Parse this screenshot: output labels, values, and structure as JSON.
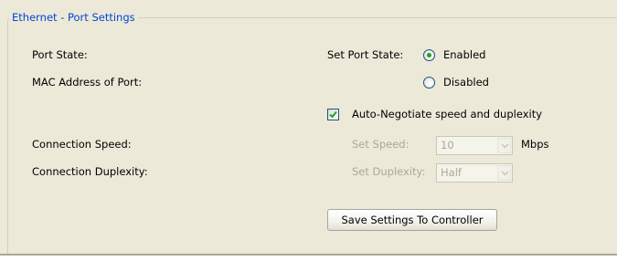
{
  "groupbox": {
    "title": "Ethernet - Port Settings"
  },
  "fields": {
    "port_state_label": "Port State:",
    "mac_address_label": "MAC Address of Port:",
    "connection_speed_label": "Connection Speed:",
    "connection_duplexity_label": "Connection Duplexity:"
  },
  "port_state_control": {
    "label": "Set Port State:",
    "options": [
      {
        "label": "Enabled",
        "selected": true
      },
      {
        "label": "Disabled",
        "selected": false
      }
    ]
  },
  "auto_negotiate": {
    "label": "Auto-Negotiate speed and duplexity",
    "checked": true
  },
  "speed": {
    "label": "Set Speed:",
    "value": "10",
    "unit": "Mbps",
    "enabled": false
  },
  "duplexity": {
    "label": "Set Duplexity:",
    "value": "Half",
    "enabled": false
  },
  "save_button": {
    "label": "Save Settings To Controller"
  },
  "colors": {
    "panel_background": "#ece9d8",
    "legend_text": "#0046d5",
    "disabled_text": "#aca899",
    "radio_dot": "#21a121"
  }
}
